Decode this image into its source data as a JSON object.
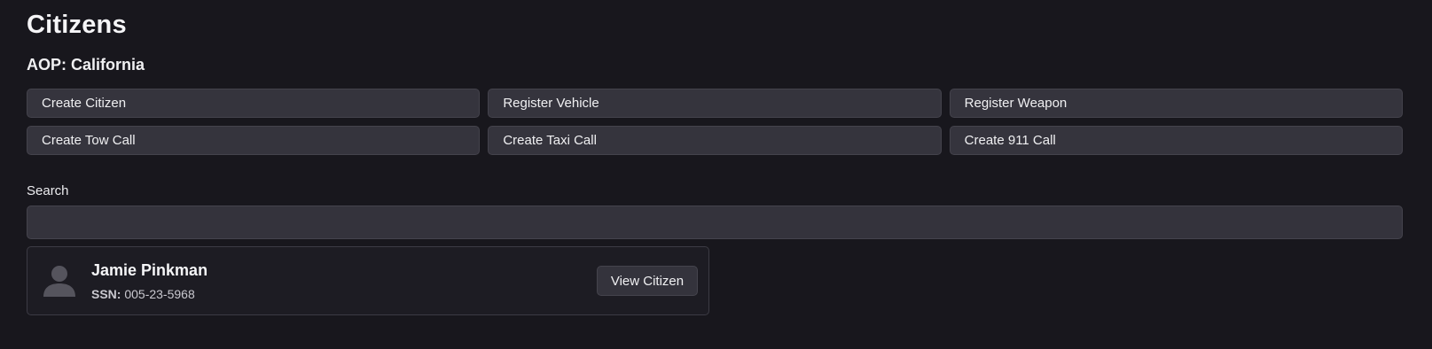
{
  "page": {
    "title": "Citizens",
    "aop": "AOP: California"
  },
  "actions": [
    {
      "label": "Create Citizen"
    },
    {
      "label": "Register Vehicle"
    },
    {
      "label": "Register Weapon"
    },
    {
      "label": "Create Tow Call"
    },
    {
      "label": "Create Taxi Call"
    },
    {
      "label": "Create 911 Call"
    }
  ],
  "search": {
    "label": "Search",
    "value": "",
    "placeholder": ""
  },
  "citizens": [
    {
      "name": "Jamie Pinkman",
      "ssn_label": "SSN:",
      "ssn": "005-23-5968",
      "avatar_icon": "user-avatar-icon",
      "view_label": "View Citizen"
    }
  ],
  "colors": {
    "background": "#18171d",
    "button_bg": "#35343d",
    "avatar": "#55545d"
  }
}
